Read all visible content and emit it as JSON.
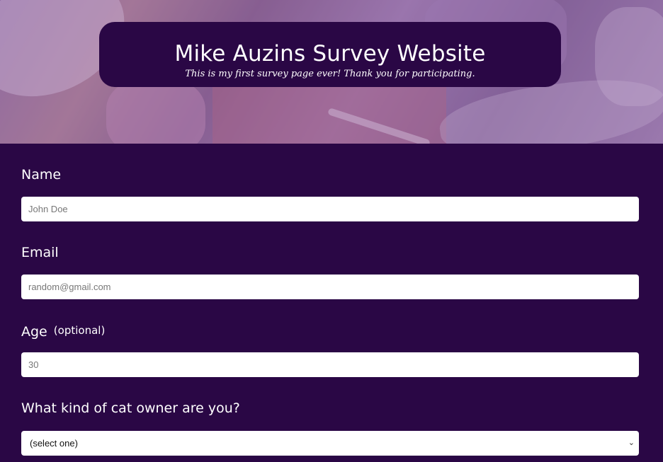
{
  "header": {
    "title": "Mike Auzins Survey Website",
    "description": "This is my first survey page ever! Thank you for participating."
  },
  "form": {
    "name": {
      "label": "Name",
      "placeholder": "John Doe"
    },
    "email": {
      "label": "Email",
      "placeholder": "random@gmail.com"
    },
    "age": {
      "label": "Age",
      "optional": "(optional)",
      "placeholder": "30"
    },
    "cat_owner": {
      "label": "What kind of cat owner are you?",
      "selected": "(select one)"
    }
  },
  "icons": {
    "dropdown": "chevron-down-icon"
  },
  "colors": {
    "background": "#2a0745",
    "text": "#ffffff",
    "field": "#ffffff"
  }
}
